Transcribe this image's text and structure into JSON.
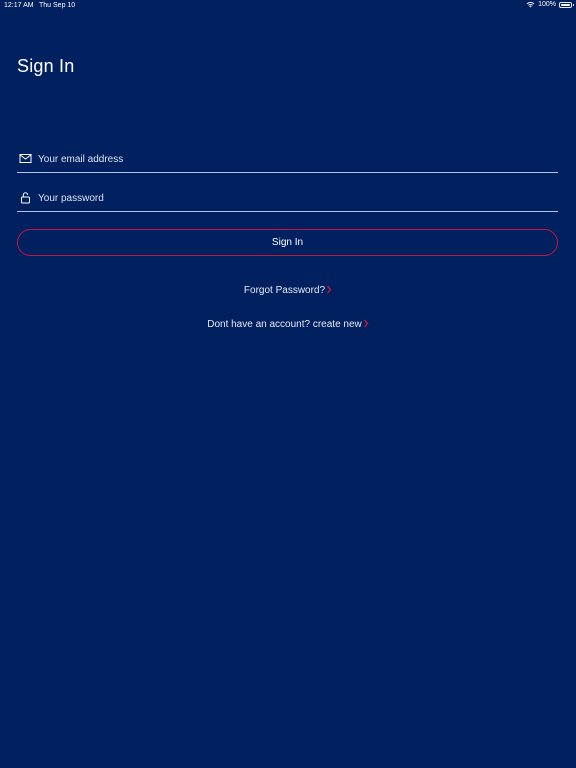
{
  "status_bar": {
    "time": "12:17 AM",
    "date": "Thu Sep 10",
    "battery_text": "100%",
    "wifi_icon": "wifi-icon",
    "battery_icon": "battery-full-icon",
    "battery_level": 1.0
  },
  "title": "Sign In",
  "form": {
    "email": {
      "icon": "envelope-icon",
      "placeholder": "Your email address",
      "value": ""
    },
    "password": {
      "icon": "lock-icon",
      "placeholder": "Your password",
      "value": ""
    },
    "submit_label": "Sign In"
  },
  "links": {
    "forgot_password": "Forgot Password?",
    "create_account": "Dont have an account? create new",
    "chevron_icon": "chevron-right-icon"
  },
  "colors": {
    "background": "#01205f",
    "accent": "#c2183e",
    "underline": "#b6c3e6",
    "text": "#ffffff"
  }
}
